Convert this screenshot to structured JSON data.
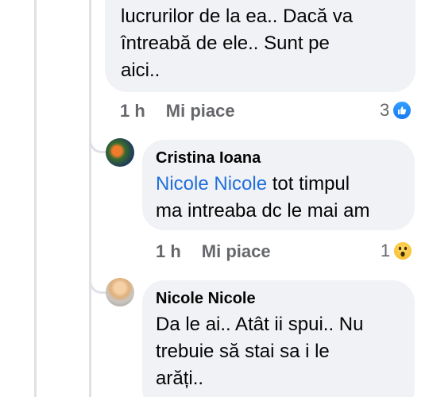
{
  "comments": [
    {
      "text_lines": [
        "lucrurilor de la ea.. Dacă va",
        "întreabă de ele.. Sunt pe",
        "aici.."
      ],
      "time": "1 h",
      "like_label": "Mi piace",
      "reaction_count": "3",
      "reaction_icon": "like-icon"
    },
    {
      "author": "Cristina Ioana",
      "mention": "Nicole Nicole",
      "text_after_mention": " tot timpul",
      "text_line2": "ma intreaba dc le mai am",
      "time": "1 h",
      "like_label": "Mi piace",
      "reaction_count": "1",
      "reaction_icon": "wow-icon"
    },
    {
      "author": "Nicole Nicole",
      "text_lines": [
        "Da le ai.. Atât ii spui.. Nu",
        "trebuie să stai sa i le",
        "arăți.."
      ]
    }
  ],
  "colors": {
    "bubble": "#f0f2f5",
    "mention": "#216fdb",
    "meta": "#65676b",
    "like_reaction": "#1877f2",
    "wow_reaction": "#f5b71c"
  }
}
